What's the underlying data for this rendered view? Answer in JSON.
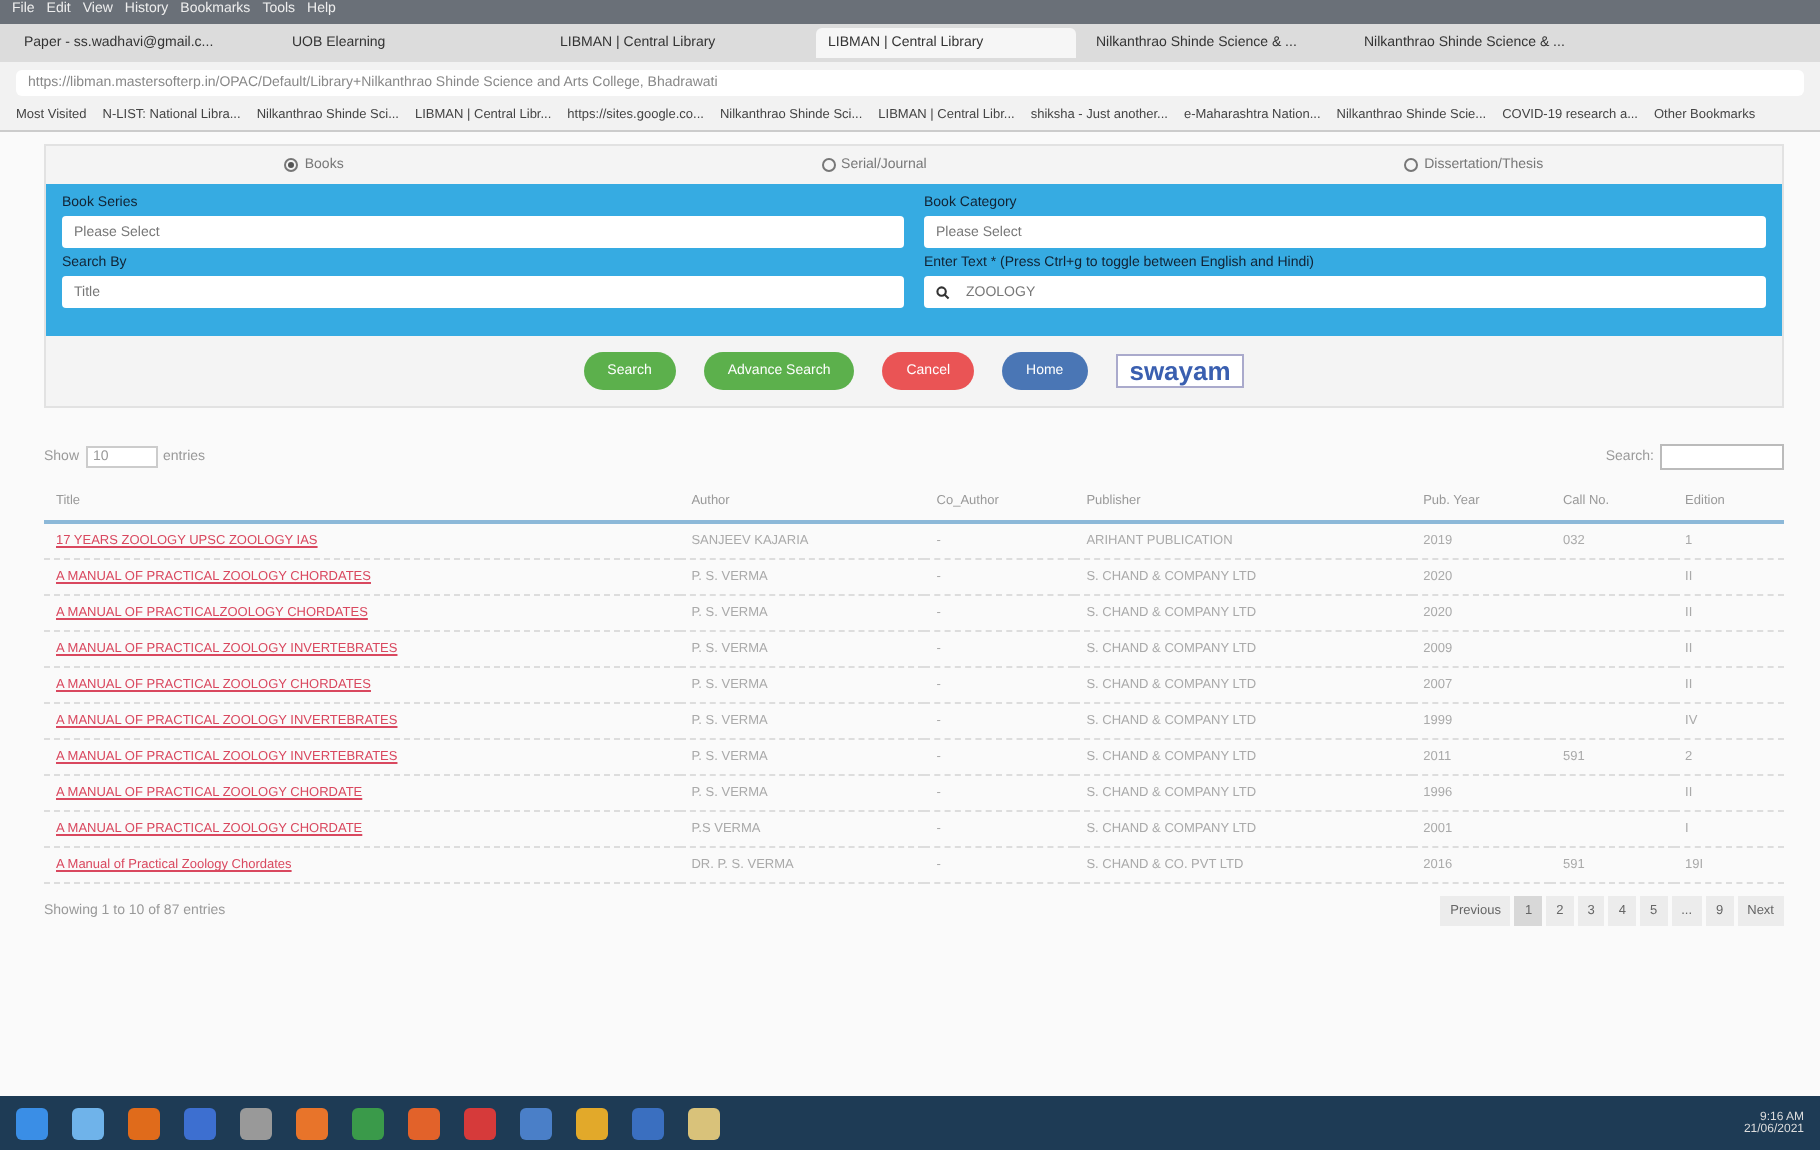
{
  "browser": {
    "menu": [
      "File",
      "Edit",
      "View",
      "History",
      "Bookmarks",
      "Tools",
      "Help"
    ],
    "tabs": [
      {
        "label": "Paper - ss.wadhavi@gmail.c...",
        "selected": false
      },
      {
        "label": "UOB Elearning",
        "selected": false
      },
      {
        "label": "LIBMAN | Central Library",
        "selected": false
      },
      {
        "label": "LIBMAN | Central Library",
        "selected": true
      },
      {
        "label": "Nilkanthrao Shinde Science & ...",
        "selected": false
      },
      {
        "label": "Nilkanthrao Shinde Science & ...",
        "selected": false
      }
    ],
    "url": "https://libman.mastersofterp.in/OPAC/Default/Library+Nilkanthrao Shinde Science and Arts College, Bhadrawati",
    "bookmarks": [
      "Most Visited",
      "N-LIST: National Libra...",
      "Nilkanthrao Shinde Sci...",
      "LIBMAN | Central Libr...",
      "https://sites.google.co...",
      "Nilkanthrao Shinde Sci...",
      "LIBMAN | Central Libr...",
      "shiksha - Just another...",
      "e-Maharashtra Nation...",
      "Nilkanthrao Shinde Scie...",
      "COVID-19 research a...",
      "Other Bookmarks"
    ]
  },
  "search_types": [
    {
      "label": "Books",
      "selected": true
    },
    {
      "label": "Serial/Journal",
      "selected": false
    },
    {
      "label": "Dissertation/Thesis",
      "selected": false
    }
  ],
  "form": {
    "book_series": {
      "label": "Book Series",
      "value": "Please Select"
    },
    "book_category": {
      "label": "Book Category",
      "value": "Please Select"
    },
    "search_by": {
      "label": "Search By",
      "value": "Title"
    },
    "text": {
      "label": "Enter Text * (Press Ctrl+g to toggle between English and Hindi)",
      "value": "ZOOLOGY"
    }
  },
  "buttons": [
    {
      "label": "Search",
      "color": "#5cb04c"
    },
    {
      "label": "Advance Search",
      "color": "#5cb04c"
    },
    {
      "label": "Cancel",
      "color": "#ea5455"
    },
    {
      "label": "Home",
      "color": "#4a76b5"
    }
  ],
  "logo": "swayam",
  "table": {
    "show_label": "Show",
    "show_value": "10",
    "entries_label": "entries",
    "search_label": "Search:",
    "columns": [
      "Title",
      "Author",
      "Co_Author",
      "Publisher",
      "Pub. Year",
      "Call No.",
      "Edition"
    ],
    "rows": [
      [
        "17 YEARS ZOOLOGY UPSC ZOOLOGY IAS",
        "SANJEEV KAJARIA",
        "-",
        "ARIHANT PUBLICATION",
        "2019",
        "032",
        "1"
      ],
      [
        "A MANUAL OF PRACTICAL ZOOLOGY CHORDATES",
        "P. S. VERMA",
        "-",
        "S. CHAND & COMPANY LTD",
        "2020",
        "",
        "II"
      ],
      [
        "A MANUAL OF PRACTICALZOOLOGY CHORDATES",
        "P. S. VERMA",
        "-",
        "S. CHAND & COMPANY LTD",
        "2020",
        "",
        "II"
      ],
      [
        "A MANUAL OF PRACTICAL ZOOLOGY INVERTEBRATES",
        "P. S. VERMA",
        "-",
        "S. CHAND & COMPANY LTD",
        "2009",
        "",
        "II"
      ],
      [
        "A MANUAL OF PRACTICAL ZOOLOGY CHORDATES",
        "P. S. VERMA",
        "-",
        "S. CHAND & COMPANY LTD",
        "2007",
        "",
        "II"
      ],
      [
        "A MANUAL OF PRACTICAL ZOOLOGY INVERTEBRATES",
        "P. S. VERMA",
        "-",
        "S. CHAND & COMPANY LTD",
        "1999",
        "",
        "IV"
      ],
      [
        "A MANUAL OF PRACTICAL ZOOLOGY INVERTEBRATES",
        "P. S. VERMA",
        "-",
        "S. CHAND & COMPANY LTD",
        "2011",
        "591",
        "2"
      ],
      [
        "A MANUAL OF PRACTICAL ZOOLOGY CHORDATE",
        "P. S. VERMA",
        "-",
        "S. CHAND & COMPANY LTD",
        "1996",
        "",
        "II"
      ],
      [
        "A MANUAL OF PRACTICAL ZOOLOGY CHORDATE",
        "P.S VERMA",
        "-",
        "S. CHAND & COMPANY LTD",
        "2001",
        "",
        "I"
      ],
      [
        "A Manual of Practical Zoology Chordates",
        "DR. P. S. VERMA",
        "-",
        "S. CHAND & CO. PVT LTD",
        "2016",
        "591",
        "19I"
      ]
    ],
    "info": "Showing 1 to 10 of 87 entries",
    "pages": [
      {
        "label": "Previous",
        "selected": false
      },
      {
        "label": "1",
        "selected": true
      },
      {
        "label": "2",
        "selected": false
      },
      {
        "label": "3",
        "selected": false
      },
      {
        "label": "4",
        "selected": false
      },
      {
        "label": "5",
        "selected": false
      },
      {
        "label": "...",
        "selected": false
      },
      {
        "label": "9",
        "selected": false
      },
      {
        "label": "Next",
        "selected": false
      }
    ]
  },
  "taskbar": {
    "time": "9:16 AM",
    "date": "21/06/2021"
  }
}
